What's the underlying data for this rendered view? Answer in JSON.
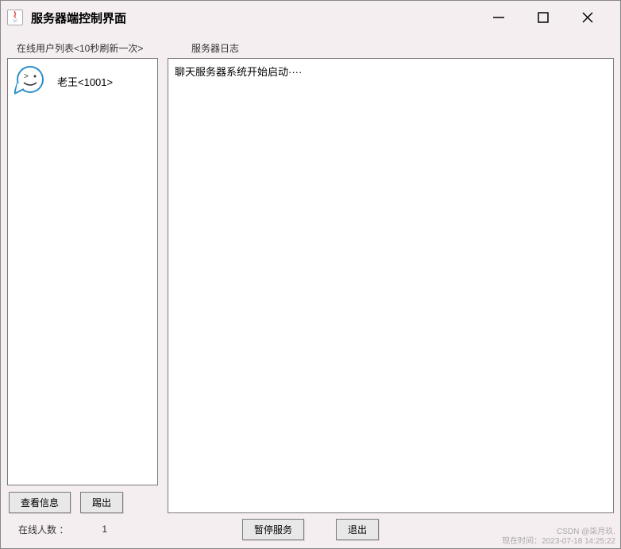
{
  "window": {
    "title": "服务器端控制界面"
  },
  "sidebar": {
    "header": "在线用户列表<10秒刷新一次>",
    "users": [
      {
        "name": "老王<1001>"
      }
    ],
    "buttons": {
      "view_info": "查看信息",
      "kick": "踢出"
    }
  },
  "log": {
    "header": "服务器日志",
    "content": "聊天服务器系统开始启动····"
  },
  "footer": {
    "online_label": "在线人数 ：",
    "online_count": "1",
    "pause_service": "暂停服务",
    "exit": "退出"
  },
  "watermark": {
    "line1": "CSDN @柒月玖.",
    "line2": "现在时间：2023-07-18 14:25:22"
  }
}
